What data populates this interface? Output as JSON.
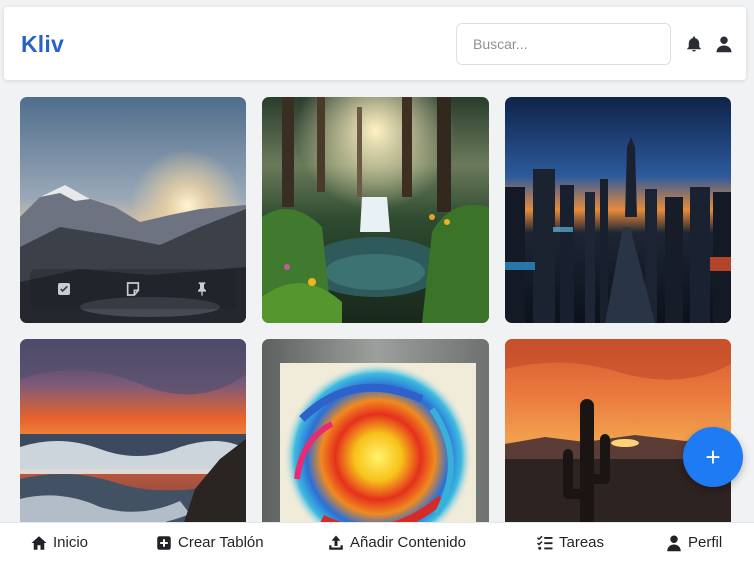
{
  "header": {
    "logo": "Kliv",
    "search_placeholder": "Buscar...",
    "icons": [
      "bell-icon",
      "user-icon"
    ]
  },
  "cards": [
    {
      "name": "mountain-sunset",
      "overlay_icons": [
        "checkbox-icon",
        "note-icon",
        "pin-icon"
      ]
    },
    {
      "name": "forest-waterfall"
    },
    {
      "name": "city-skyline-dusk"
    },
    {
      "name": "ocean-sunset-waves"
    },
    {
      "name": "abstract-swirl-painting"
    },
    {
      "name": "desert-cactus-sunset"
    }
  ],
  "fab": {
    "label": "+"
  },
  "bottom_nav": {
    "items": [
      {
        "label": "Inicio",
        "icon": "home-icon"
      },
      {
        "label": "Crear Tablón",
        "icon": "plus-square-icon"
      },
      {
        "label": "Añadir Contenido",
        "icon": "upload-icon"
      },
      {
        "label": "Tareas",
        "icon": "tasks-icon"
      },
      {
        "label": "Perfil",
        "icon": "user-icon"
      }
    ]
  },
  "colors": {
    "brand": "#2563c9",
    "fab": "#1e7bf4",
    "background": "#f1f2f4"
  }
}
